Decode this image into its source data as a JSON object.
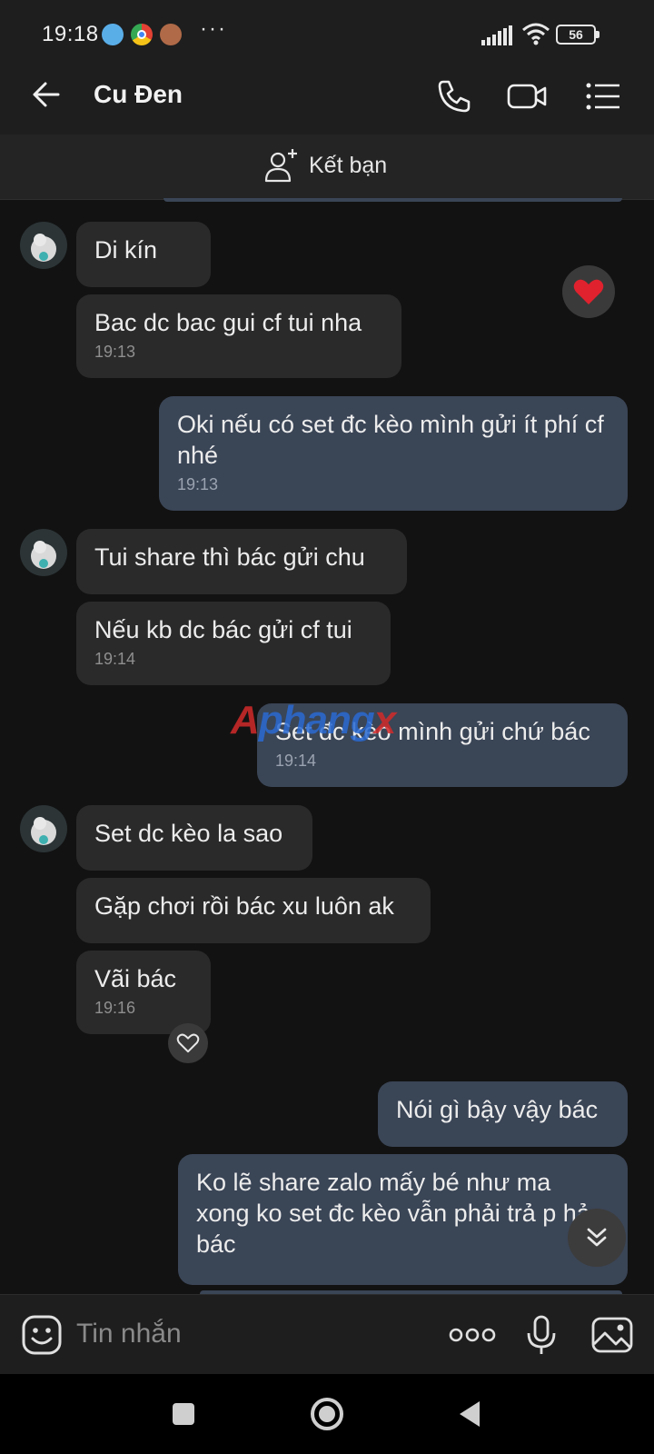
{
  "status_bar": {
    "time": "19:18",
    "battery": "56",
    "more": "···"
  },
  "header": {
    "contact_name": "Cu Đen"
  },
  "friend_bar": {
    "label": "Kết bạn"
  },
  "messages": [
    {
      "side": "in",
      "text": "Di kín",
      "time": ""
    },
    {
      "side": "in",
      "text": "Bac dc bac gui cf tui nha",
      "time": "19:13"
    },
    {
      "side": "out",
      "text": "Oki nếu có set đc kèo mình gửi ít phí cf nhé",
      "time": "19:13"
    },
    {
      "side": "in",
      "text": "Tui share thì bác gửi chu",
      "time": ""
    },
    {
      "side": "in",
      "text": "Nếu kb dc bác gửi cf tui",
      "time": "19:14"
    },
    {
      "side": "out",
      "text": "Set đc kèo mình gửi chứ bác",
      "time": "19:14"
    },
    {
      "side": "in",
      "text": "Set dc kèo la sao",
      "time": ""
    },
    {
      "side": "in",
      "text": "Gặp chơi rồi bác xu luôn ak",
      "time": ""
    },
    {
      "side": "in",
      "text": "Vãi bác",
      "time": "19:16"
    },
    {
      "side": "out",
      "text": "Nói gì bậy vậy bác",
      "time": ""
    },
    {
      "side": "out",
      "text": "Ko lẽ share zalo mấy bé như ma xong ko set đc kèo vẫn phải trả p hả bác",
      "time": ""
    }
  ],
  "watermark": {
    "part1": "A",
    "part2": "phang",
    "part3": "x"
  },
  "input_bar": {
    "placeholder": "Tin nhắn"
  },
  "colors": {
    "incoming_bubble": "#2a2a2a",
    "outgoing_bubble": "#3a4556",
    "background": "#121212",
    "heart": "#e0222e"
  }
}
